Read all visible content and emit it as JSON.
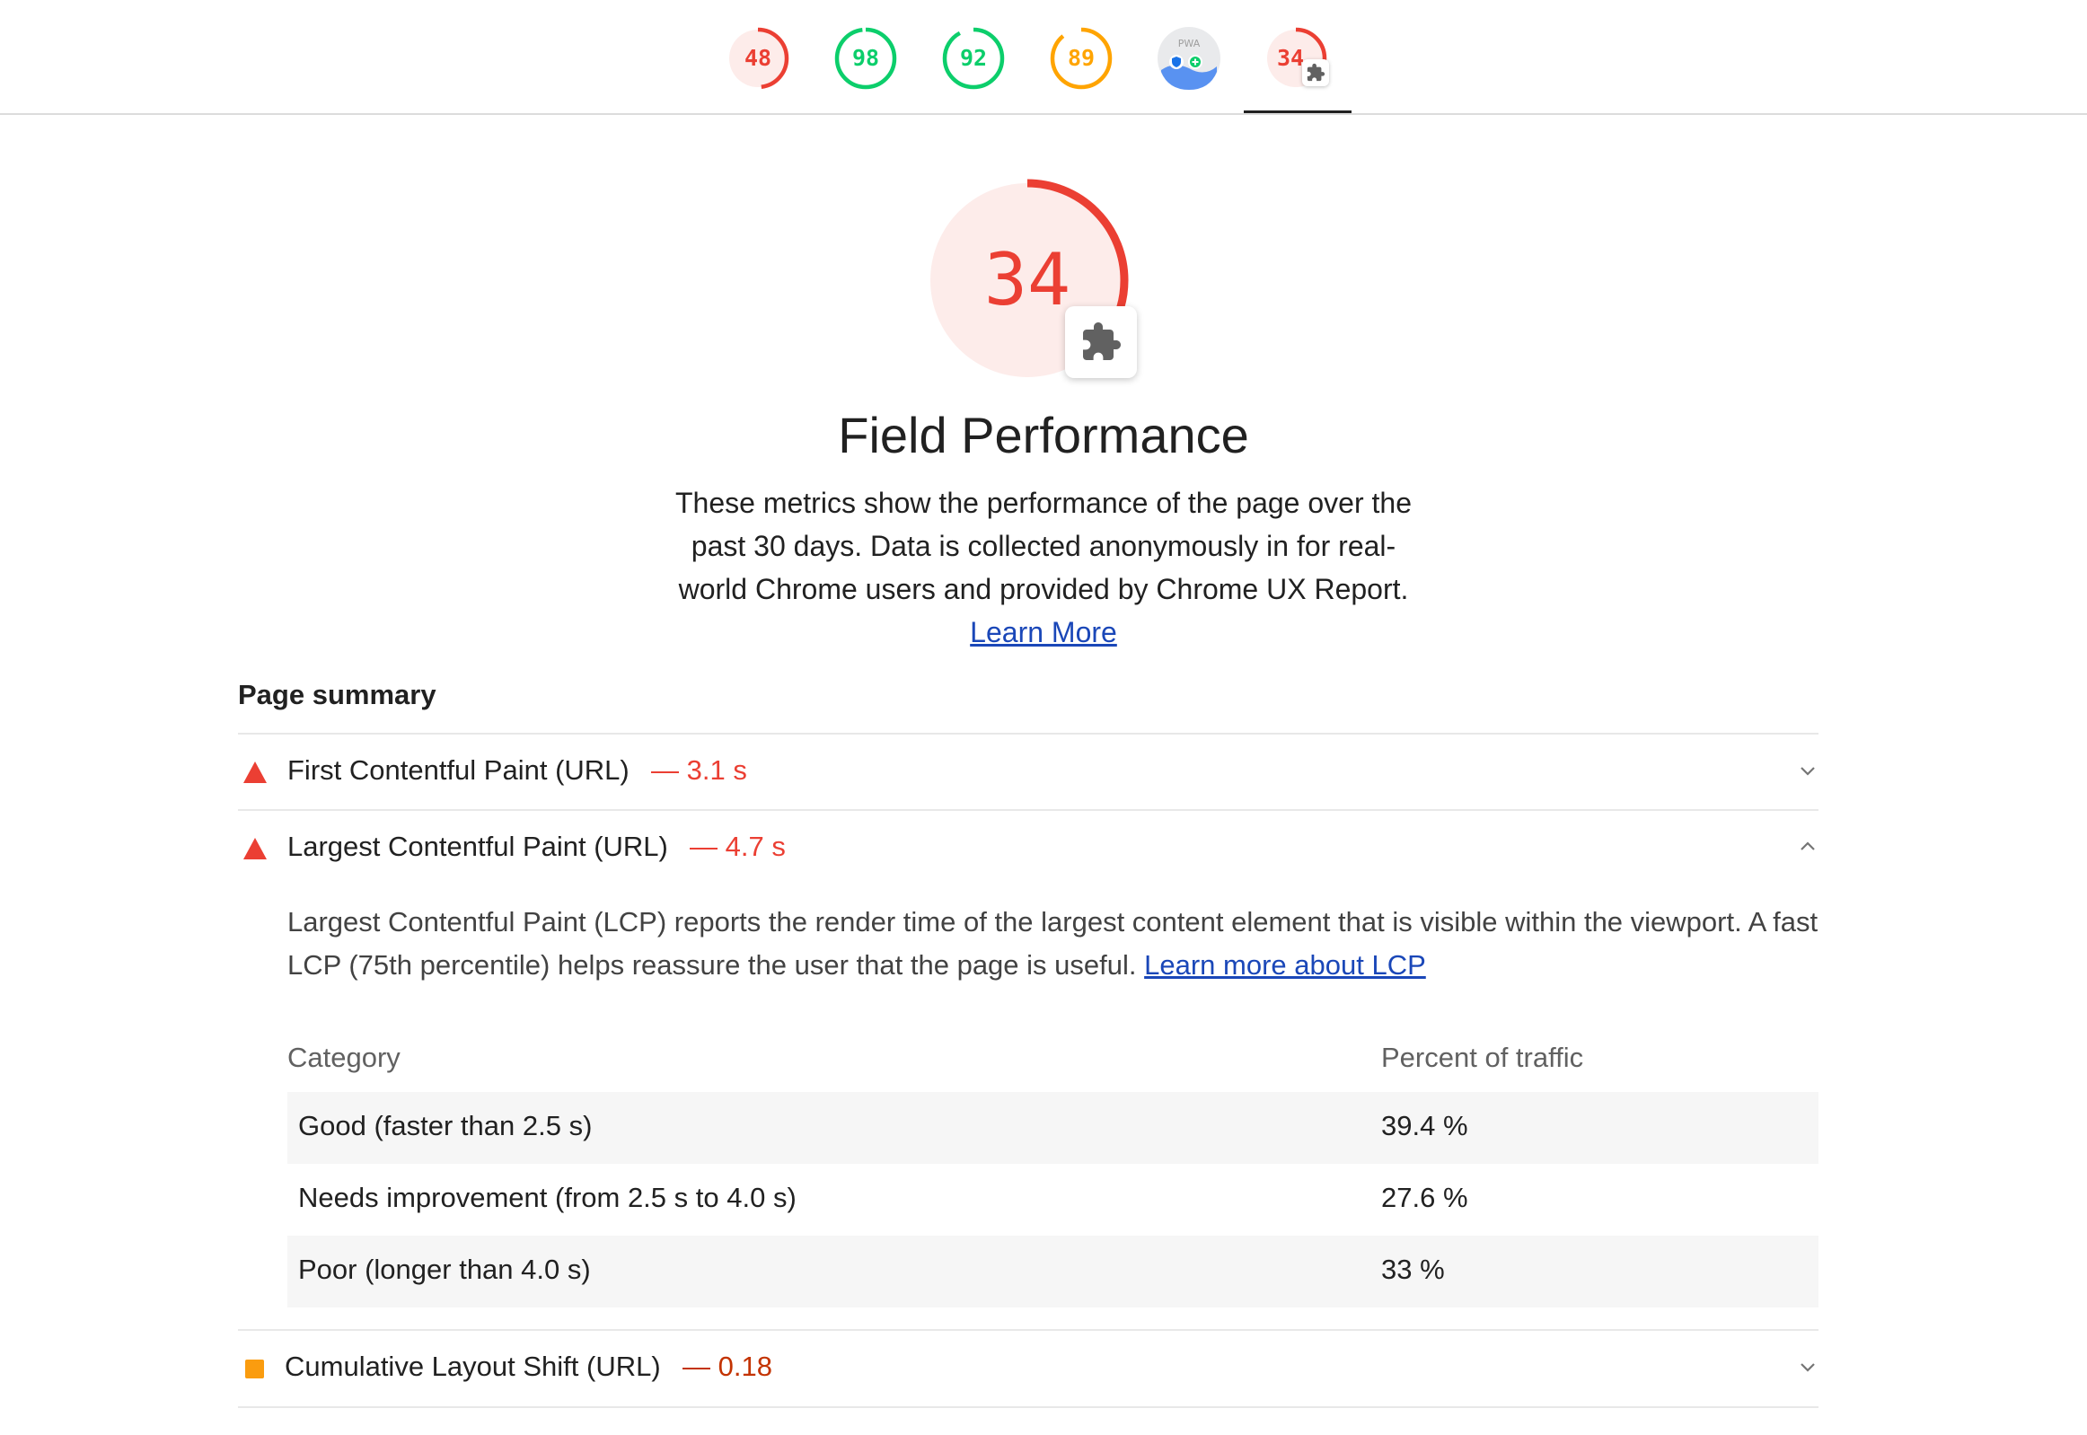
{
  "scores": [
    {
      "value": "48",
      "color": "#eb3f33",
      "fill": 0.48
    },
    {
      "value": "98",
      "color": "#0cce6b",
      "fill": 0.98
    },
    {
      "value": "92",
      "color": "#0cce6b",
      "fill": 0.92
    },
    {
      "value": "89",
      "color": "#ffa400",
      "fill": 0.89
    },
    {
      "value": "PWA",
      "icon": "pwa-icon"
    },
    {
      "value": "34",
      "color": "#eb3f33",
      "fill": 0.34,
      "icon": "puzzle-icon"
    }
  ],
  "category": {
    "score": "34",
    "score_fill": 0.34,
    "score_color": "#eb3f33",
    "icon": "puzzle-icon",
    "title": "Field Performance",
    "description": "These metrics show the performance of the page over the past 30 days. Data is collected anonymously in for real-world Chrome users and provided by Chrome UX Report.",
    "learn_more": "Learn More"
  },
  "page_summary": {
    "title": "Page summary",
    "metrics": [
      {
        "label": "First Contentful Paint (URL)",
        "value": "— 3.1 s",
        "status": "fail",
        "expanded": false,
        "value_color": "#eb3f33",
        "icon": "fail-triangle-icon"
      },
      {
        "label": "Largest Contentful Paint (URL)",
        "value": "— 4.7 s",
        "status": "fail",
        "expanded": true,
        "value_color": "#eb3f33",
        "icon": "fail-triangle-icon",
        "description": "Largest Contentful Paint (LCP) reports the render time of the largest content element that is visible within the viewport. A fast LCP (75th percentile) helps reassure the user that the page is useful.",
        "learn_more": "Learn more about LCP"
      },
      {
        "label": "Cumulative Layout Shift (URL)",
        "value": "— 0.18",
        "status": "average",
        "expanded": false,
        "value_color": "#c33300",
        "icon": "average-square-icon"
      }
    ]
  },
  "lcp_table": {
    "headers": [
      "Category",
      "Percent of traffic"
    ],
    "rows": [
      {
        "category": "Good (faster than 2.5 s)",
        "percent": "39.4 %"
      },
      {
        "category": "Needs improvement (from 2.5 s to 4.0 s)",
        "percent": "27.6 %"
      },
      {
        "category": "Poor (longer than 4.0 s)",
        "percent": "33 %"
      }
    ]
  }
}
